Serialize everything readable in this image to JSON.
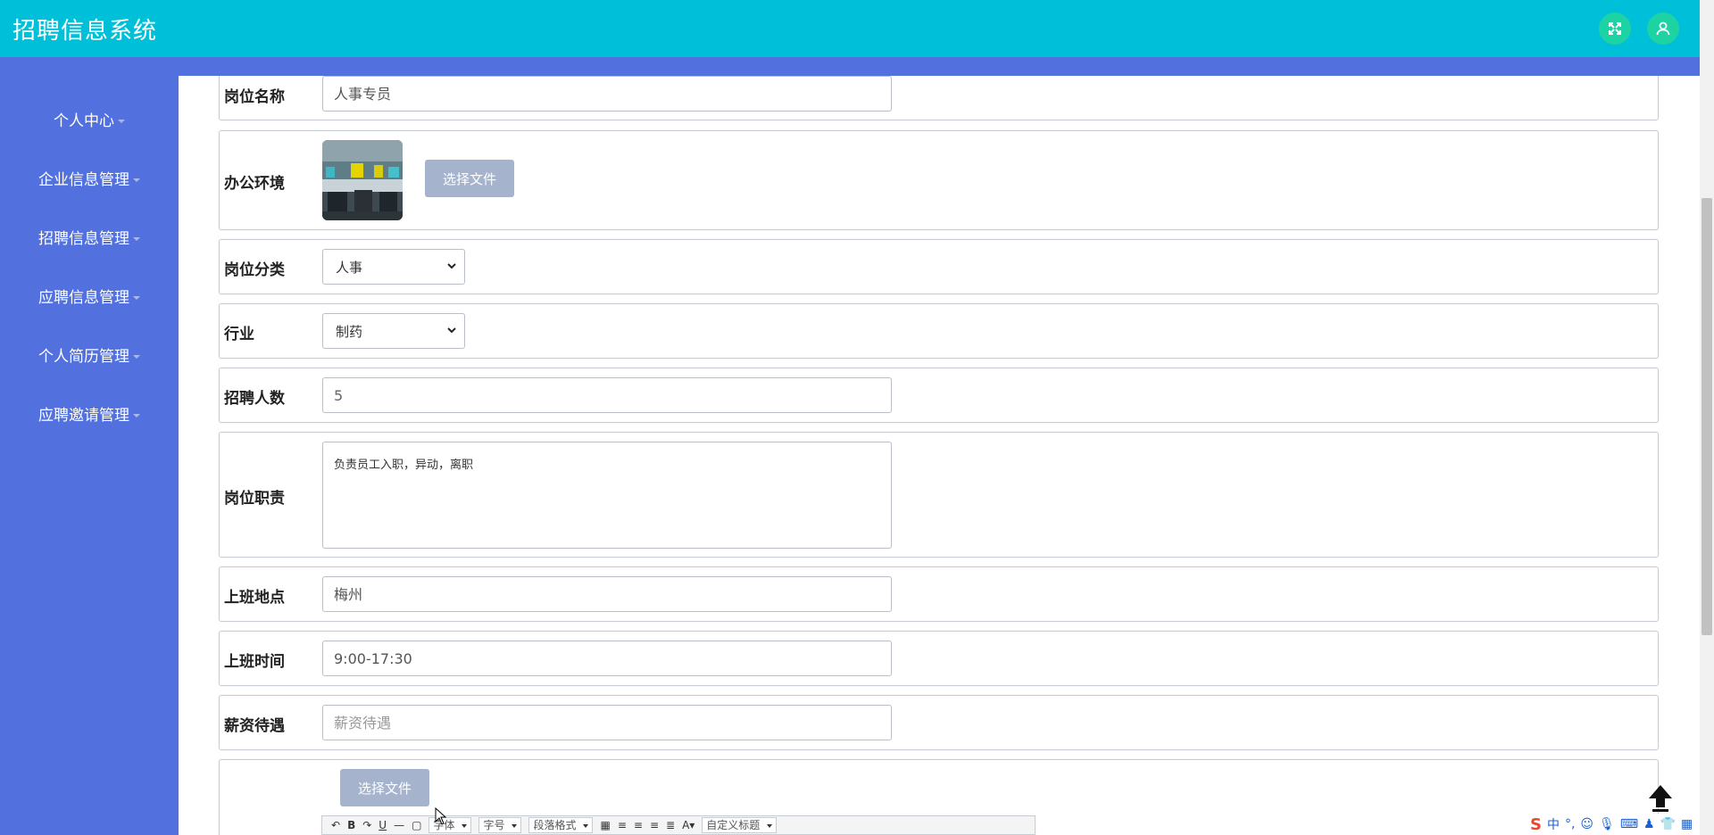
{
  "header": {
    "title": "招聘信息系统"
  },
  "sidebar": {
    "items": [
      {
        "label": "个人中心"
      },
      {
        "label": "企业信息管理"
      },
      {
        "label": "招聘信息管理"
      },
      {
        "label": "应聘信息管理"
      },
      {
        "label": "个人简历管理"
      },
      {
        "label": "应聘邀请管理"
      }
    ]
  },
  "form": {
    "position_name": {
      "label": "岗位名称",
      "value": "人事专员"
    },
    "office_env": {
      "label": "办公环境",
      "button": "选择文件"
    },
    "position_category": {
      "label": "岗位分类",
      "selected": "人事"
    },
    "industry": {
      "label": "行业",
      "selected": "制药"
    },
    "headcount": {
      "label": "招聘人数",
      "value": "5"
    },
    "duties": {
      "label": "岗位职责",
      "value": "负责员工入职，异动，离职"
    },
    "work_location": {
      "label": "上班地点",
      "value": "梅州"
    },
    "work_hours": {
      "label": "上班时间",
      "value": "9:00-17:30"
    },
    "salary": {
      "label": "薪资待遇",
      "placeholder": "薪资待遇"
    },
    "detail_upload": {
      "button": "选择文件"
    }
  },
  "editor": {
    "font": "字体",
    "size": "字号",
    "paragraph": "段落格式",
    "custom_title": "自定义标题"
  },
  "ime": {
    "lang": "中"
  }
}
